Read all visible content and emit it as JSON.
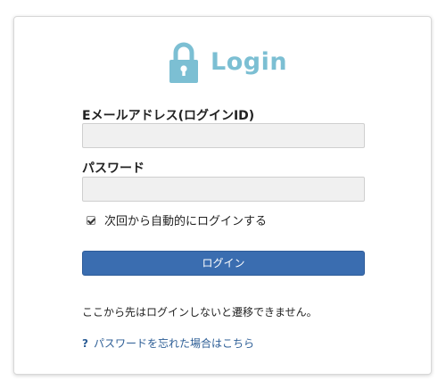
{
  "header": {
    "title": "Login",
    "icon": "lock-icon",
    "accent_color": "#7cbfd3"
  },
  "form": {
    "email_label": "Eメールアドレス(ログインID)",
    "email_value": "",
    "password_label": "パスワード",
    "password_value": "",
    "remember_label": "次回から自動的にログインする",
    "remember_checked": true,
    "submit_label": "ログイン",
    "submit_color": "#3a6db0"
  },
  "notice": "ここから先はログインしないと遷移できません。",
  "forgot": {
    "icon": "question-icon",
    "icon_text": "?",
    "label": "パスワードを忘れた場合はこちら",
    "link_color": "#2d5e96"
  }
}
